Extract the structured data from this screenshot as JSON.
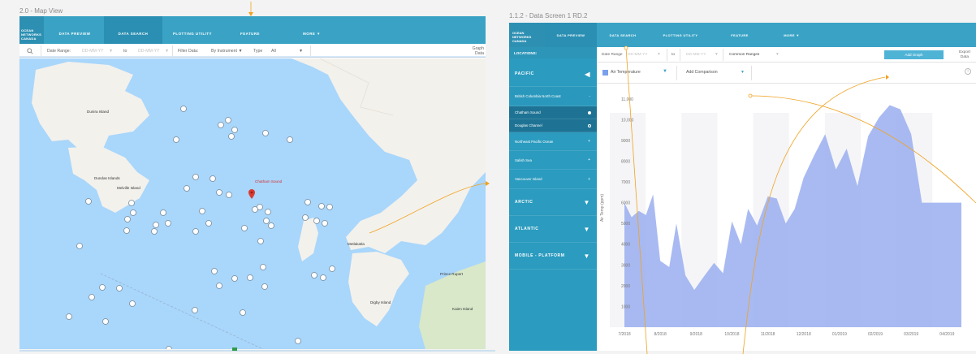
{
  "board1_title": "2.0 - Map View",
  "board2_title": "1.1.2 - Data Screen 1 RD.2",
  "brand": "OCEAN NETWORKS CANADA",
  "nav1": [
    "DATA PREVIEW",
    "DATA SEARCH",
    "PLOTTING UTILITY",
    "FEATURE",
    "MORE ▼"
  ],
  "filter1": {
    "date_label": "Date Range:",
    "date_from": "DD-MM-YY",
    "to": "to",
    "date_to": "DD-MM-YY",
    "filter_label": "Filter Data:",
    "by_instrument": "By Instrument ▼",
    "type_label": "Type",
    "type_value": "All",
    "graph_data": "Graph Data"
  },
  "map_labels": {
    "dundas_top": "Dunira Island",
    "dundas": "Dundas Islands",
    "melville": "Melville Island",
    "chatham": "Chatham Sound",
    "metlakatla": "Metlakatla",
    "prince_rupert": "Prince Rupert",
    "digby": "Digby Island",
    "kaien": "Kaien Island"
  },
  "nav2": [
    "DATA PREVIEW",
    "DATA SEARCH",
    "PLOTTING UTILITY",
    "FEATURE",
    "MORE ▼"
  ],
  "sidebar": {
    "locations": "LOCATIONS:",
    "regions": [
      "PACIFIC",
      "ARCTIC",
      "ATLANTIC",
      "MOBILE - PLATFORM"
    ],
    "subs": [
      "British Columbia North Coast",
      "Chatham Sound",
      "Douglas Channel",
      "Northeast Pacific Ocean",
      "Salish Sea",
      "Vancouver Island"
    ]
  },
  "filter2": {
    "date_label": "Date Range",
    "date_from": "DD-MM-YY",
    "to": "to",
    "date_to": "DD-MM-YY",
    "common": "Common Ranges",
    "add_graph": "Add Graph",
    "export": "Export Data"
  },
  "selector": {
    "variable": "Air Temperature",
    "add_comparison": "Add Comparison"
  },
  "colors": {
    "accent": "#3aa3c5",
    "sidebar": "#2b9bbf",
    "series": "#9aaef0",
    "annotation": "#f0a21f",
    "water": "#a9d6fb"
  },
  "chart_data": {
    "type": "area",
    "ylabel": "Air Temp (ppm)",
    "ylim": [
      0,
      11500
    ],
    "yticks": [
      1000,
      2000,
      3000,
      4000,
      5000,
      6000,
      7000,
      8000,
      9000,
      10000,
      11000
    ],
    "ytick_labels": [
      "1000",
      "2000",
      "3000",
      "4000",
      "5000",
      "6000",
      "7000",
      "8000",
      "9000",
      "10,000",
      "11,000"
    ],
    "xtick_labels": [
      "7/2018",
      "8/2018",
      "9/2018",
      "10/2018",
      "11/2018",
      "12/2018",
      "01/2019",
      "02/2019",
      "03/2019",
      "04/2019"
    ],
    "series": [
      {
        "x": [
          0,
          0.2,
          0.4,
          0.6,
          0.8,
          1.0,
          1.25,
          1.45,
          1.7,
          1.95,
          2.2,
          2.5,
          2.75,
          3.0,
          3.25,
          3.45,
          3.7,
          4.0,
          4.25,
          4.5,
          4.75,
          5.0,
          5.3,
          5.6,
          5.9,
          6.2,
          6.5,
          6.8,
          7.1,
          7.4,
          7.7,
          8.0,
          8.3,
          8.5,
          8.7,
          9.0,
          9.2,
          9.4
        ],
        "values": [
          6000,
          5300,
          5600,
          5400,
          6400,
          3200,
          2900,
          5000,
          2500,
          1800,
          2400,
          3100,
          2600,
          5100,
          4000,
          5700,
          4900,
          6300,
          6200,
          5000,
          5700,
          7200,
          8300,
          9300,
          7600,
          8600,
          6800,
          9200,
          10100,
          10700,
          10500,
          9300,
          6000,
          6000,
          6000,
          6000,
          6000,
          6000
        ]
      }
    ]
  }
}
